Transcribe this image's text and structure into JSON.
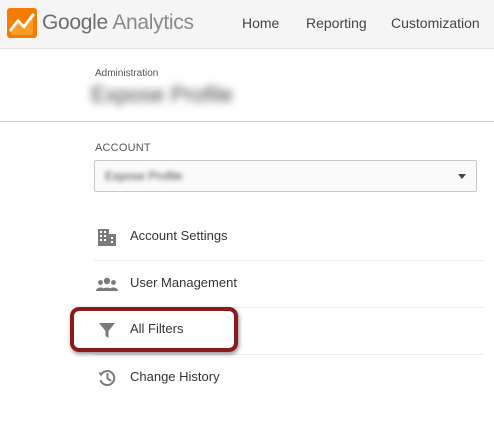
{
  "header": {
    "logo_google": "Google",
    "logo_product": "Analytics",
    "nav": {
      "home": "Home",
      "reporting": "Reporting",
      "customization": "Customization"
    }
  },
  "admin": {
    "section_label": "Administration",
    "property_title": "Expose Profile"
  },
  "account": {
    "label": "ACCOUNT",
    "selected_value": "Expose Profile"
  },
  "menu": {
    "items": [
      {
        "label": "Account Settings",
        "icon": "building-icon"
      },
      {
        "label": "User Management",
        "icon": "users-icon"
      },
      {
        "label": "All Filters",
        "icon": "filter-icon",
        "highlighted": true
      },
      {
        "label": "Change History",
        "icon": "history-icon"
      }
    ]
  },
  "colors": {
    "logo_orange": "#f57c00",
    "highlight_border": "#8b1a1a",
    "icon_gray": "#7a7a7a"
  }
}
